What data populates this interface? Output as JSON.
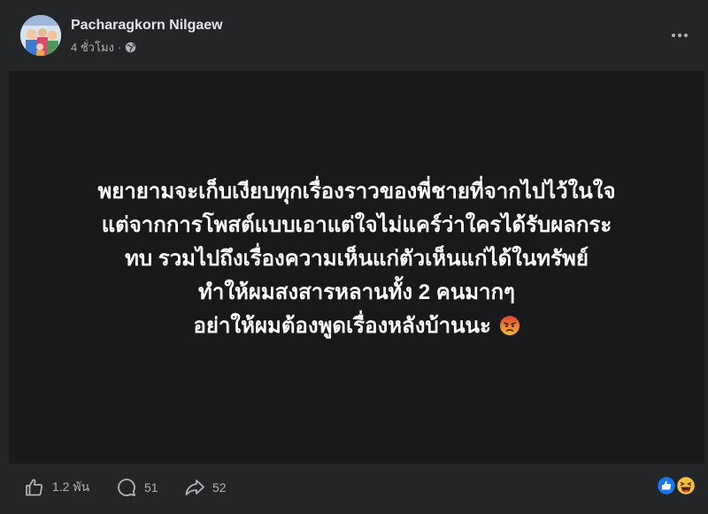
{
  "post": {
    "author_name": "Pacharagkorn Nilgaew",
    "timestamp": "4 ชั่วโมง",
    "separator": "·",
    "privacy_icon": "globe-icon",
    "text_lines": [
      "พยายามจะเก็บเงียบทุกเรื่องราวของพี่ชายที่จากไปไว้ในใจ",
      "แต่จากการโพสต์แบบเอาแต่ใจไม่แคร์ว่าใครได้รับผลกระ",
      "ทบ รวมไปถึงเรื่องความเห็นแก่ตัวเห็นแก่ได้ในทรัพย์",
      "ทำให้ผมสงสารหลานทั้ง 2 คนมากๆ",
      "อย่าให้ผมต้องพูดเรื่องหลังบ้านนะ"
    ],
    "text_emoji": "angry-face-icon",
    "background_color": "#18191a"
  },
  "actions": {
    "like_count": "1.2 พัน",
    "comment_count": "51",
    "share_count": "52"
  },
  "reactions": [
    "like-reaction-icon",
    "haha-reaction-icon"
  ],
  "colors": {
    "surface": "#242526",
    "text_primary": "#e4e6eb",
    "text_secondary": "#b0b3b8",
    "like_blue": "#1877f2"
  }
}
